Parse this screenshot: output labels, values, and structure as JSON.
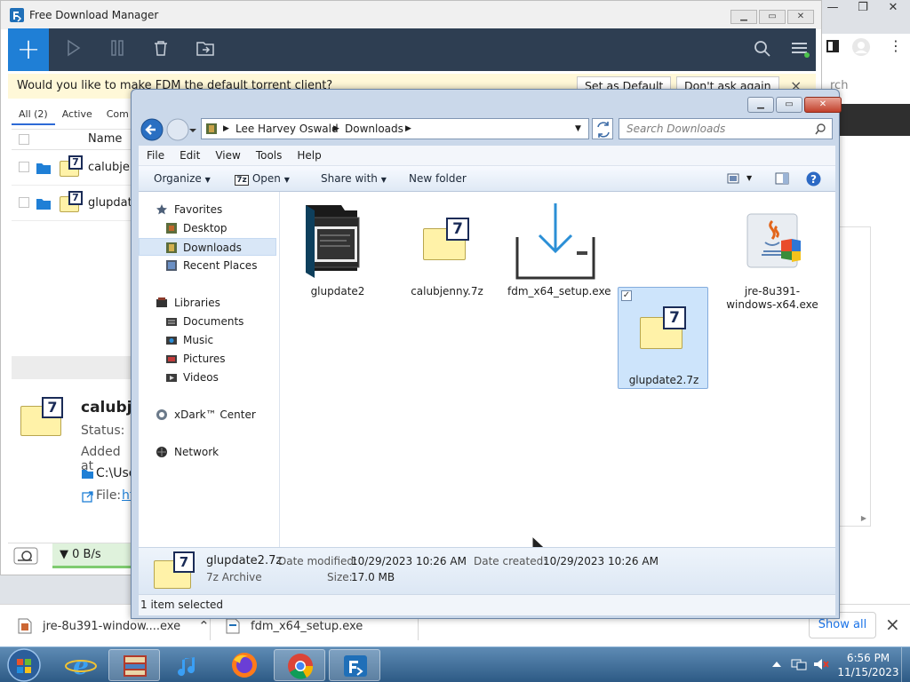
{
  "fdm": {
    "title": "Free Download Manager",
    "add_label": "+",
    "notify_text": "Would you like to make FDM the default torrent client?",
    "set_default": "Set as Default",
    "dont_ask": "Don't ask again",
    "close_x": "×",
    "tabs": [
      "All (2)",
      "Active",
      "Com"
    ],
    "name_header": "Name",
    "rows": [
      "calubjer",
      "glupdate"
    ],
    "detail": {
      "name": "calubje",
      "status": "Status:",
      "added": "Added at",
      "path": "C:\\Use",
      "file_label": "File:",
      "file_link": "ht"
    },
    "speed": "▼ 0 B/s"
  },
  "browser": {
    "search_fragment": "rch"
  },
  "downloads_bar": {
    "items": [
      "jre-8u391-window....exe",
      "fdm_x64_setup.exe"
    ],
    "show_all": "Show all",
    "close": "×"
  },
  "explorer": {
    "breadcrumb": [
      "Lee Harvey Oswald",
      "Downloads"
    ],
    "search_placeholder": "Search Downloads",
    "menu": [
      "File",
      "Edit",
      "View",
      "Tools",
      "Help"
    ],
    "commands": {
      "organize": "Organize",
      "open": "Open",
      "share": "Share with",
      "new_folder": "New folder"
    },
    "nav": {
      "favorites": "Favorites",
      "desktop": "Desktop",
      "downloads": "Downloads",
      "recent": "Recent Places",
      "libraries": "Libraries",
      "documents": "Documents",
      "music": "Music",
      "pictures": "Pictures",
      "videos": "Videos",
      "xdark": "xDark™ Center",
      "network": "Network"
    },
    "files": [
      {
        "name": "glupdate2",
        "icon": "folder-dark-icon"
      },
      {
        "name": "calubjenny.7z",
        "icon": "7z-archive-icon"
      },
      {
        "name": "fdm_x64_setup.exe",
        "icon": "download-icon"
      },
      {
        "name": "glupdate2.7z",
        "icon": "7z-archive-icon",
        "selected": true
      },
      {
        "name": "jre-8u391-windows-x64.exe",
        "icon": "java-icon"
      }
    ],
    "details_pane": {
      "name": "glupdate2.7z",
      "type": "7z Archive",
      "modified_label": "Date modified:",
      "modified_value": "10/29/2023 10:26 AM",
      "size_label": "Size:",
      "size_value": "17.0 MB",
      "created_label": "Date created:",
      "created_value": "10/29/2023 10:26 AM"
    },
    "status": "1 item selected"
  },
  "taskbar": {
    "time": "6:56 PM",
    "date": "11/15/2023"
  },
  "colors": {
    "fdm_toolbar": "#2e3e52",
    "fdm_accent": "#1f7fd6",
    "explorer_frame": "#cad8ea",
    "selection": "#cde4fb",
    "taskbar": "#2d5a85"
  }
}
